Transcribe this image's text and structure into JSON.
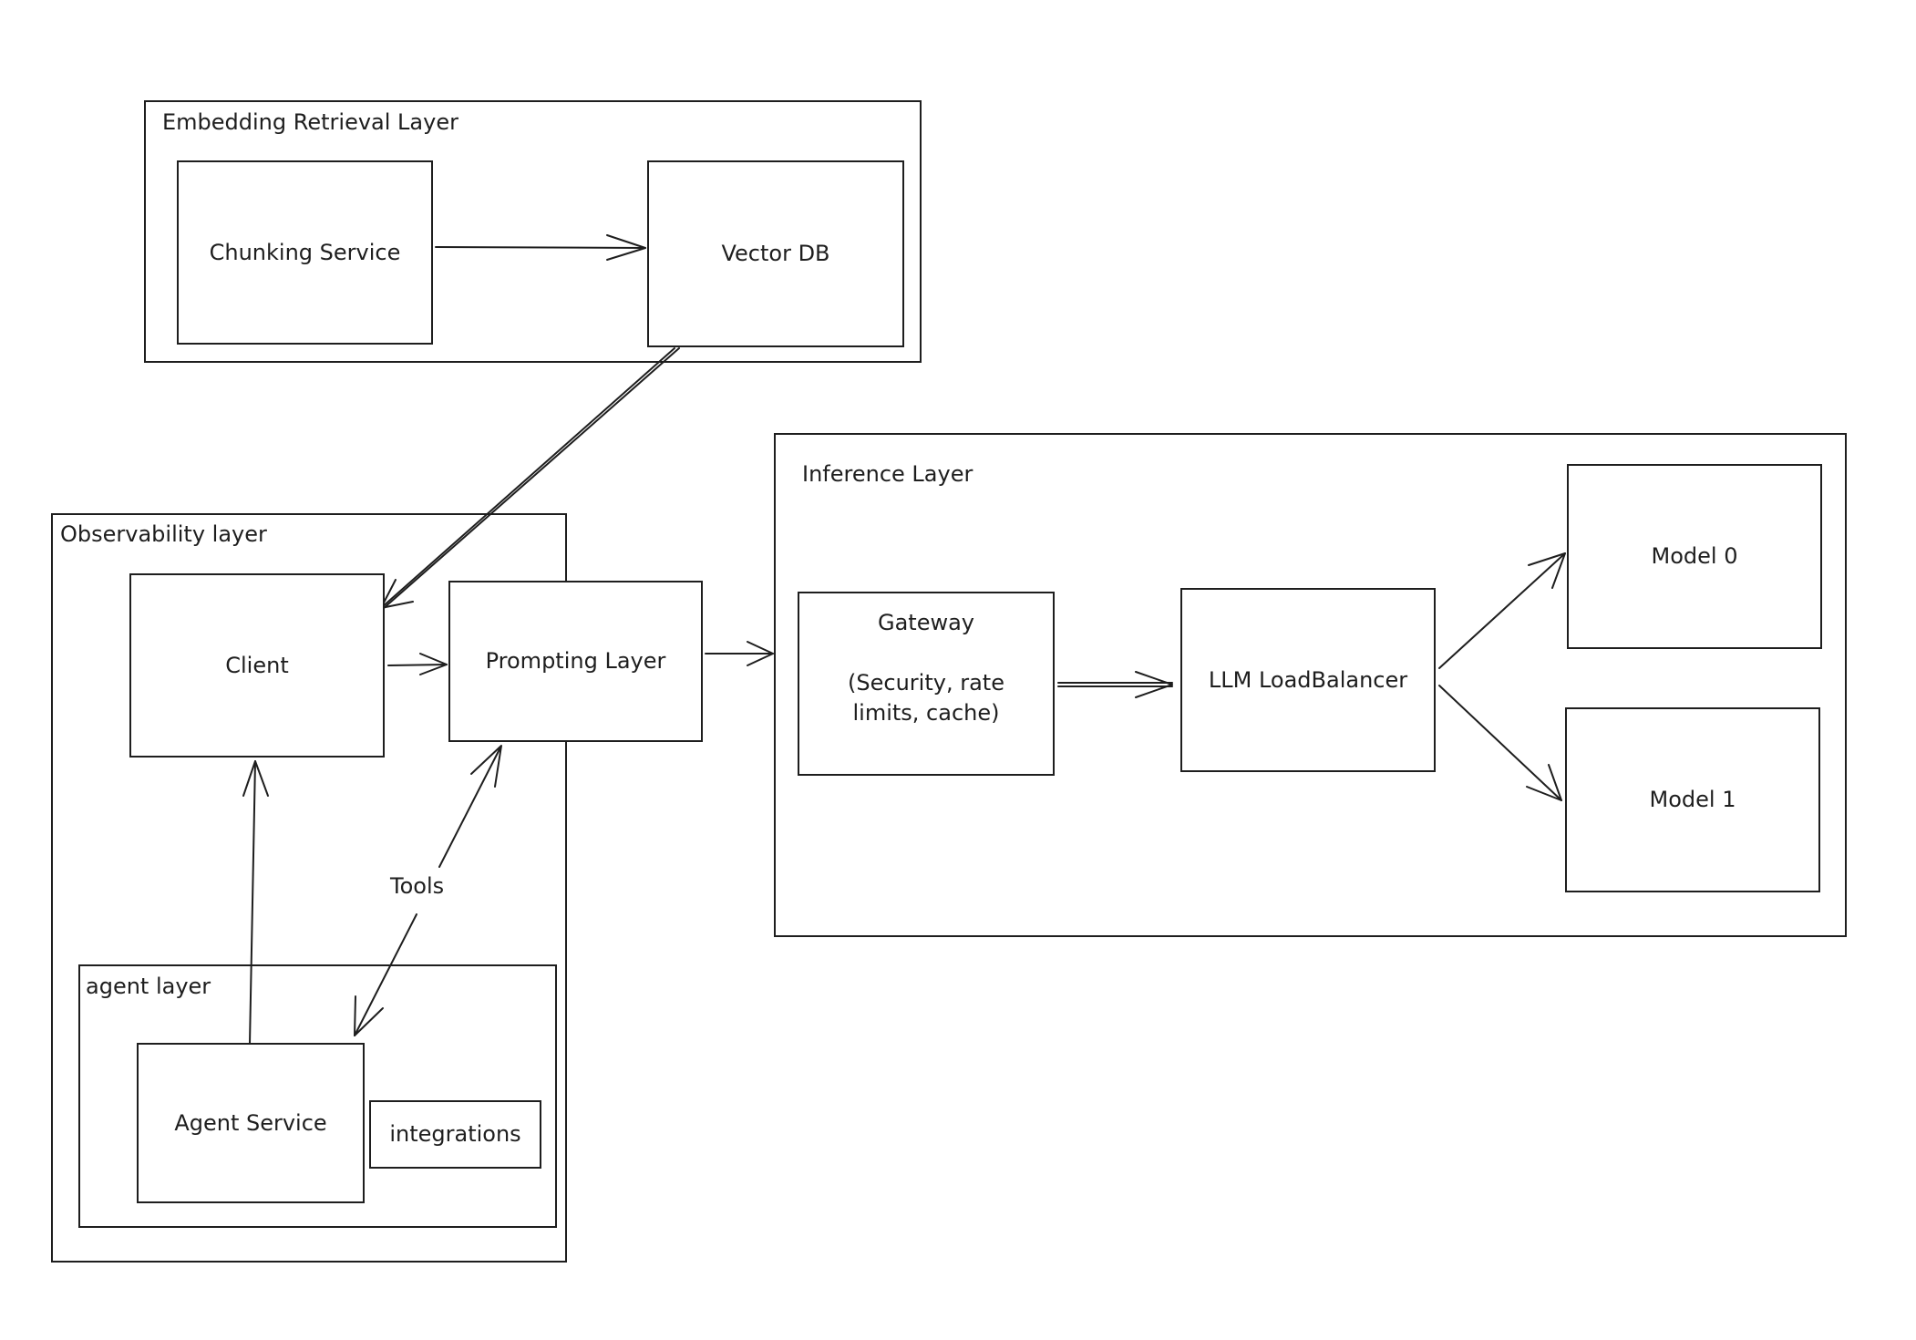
{
  "groups": {
    "embedding": {
      "label": "Embedding Retrieval Layer"
    },
    "observability": {
      "label": "Observability layer"
    },
    "inference": {
      "label": "Inference Layer"
    },
    "agent": {
      "label": "agent layer"
    }
  },
  "nodes": {
    "chunking": {
      "label": "Chunking Service"
    },
    "vectordb": {
      "label": "Vector DB"
    },
    "client": {
      "label": "Client"
    },
    "prompting": {
      "label": "Prompting Layer"
    },
    "gateway": {
      "title": "Gateway",
      "subtitle": "(Security, rate\nlimits, cache)"
    },
    "loadbalancer": {
      "label": "LLM LoadBalancer"
    },
    "model0": {
      "label": "Model 0"
    },
    "model1": {
      "label": "Model 1"
    },
    "agent_service": {
      "label": "Agent Service"
    },
    "integrations": {
      "label": "integrations"
    }
  },
  "edges": [
    {
      "from": "Chunking Service",
      "to": "Vector DB",
      "label": ""
    },
    {
      "from": "Vector DB",
      "to": "Client",
      "label": ""
    },
    {
      "from": "Client",
      "to": "Prompting Layer",
      "label": ""
    },
    {
      "from": "Prompting Layer",
      "to": "Gateway",
      "label": ""
    },
    {
      "from": "Gateway",
      "to": "LLM LoadBalancer",
      "label": ""
    },
    {
      "from": "LLM LoadBalancer",
      "to": "Model 0",
      "label": ""
    },
    {
      "from": "LLM LoadBalancer",
      "to": "Model 1",
      "label": ""
    },
    {
      "from": "Agent Service",
      "to": "Client",
      "label": ""
    },
    {
      "from": "Agent Service",
      "to": "Prompting Layer",
      "label": "Tools",
      "bidirectional": true
    }
  ],
  "edge_labels": {
    "tools": "Tools"
  }
}
